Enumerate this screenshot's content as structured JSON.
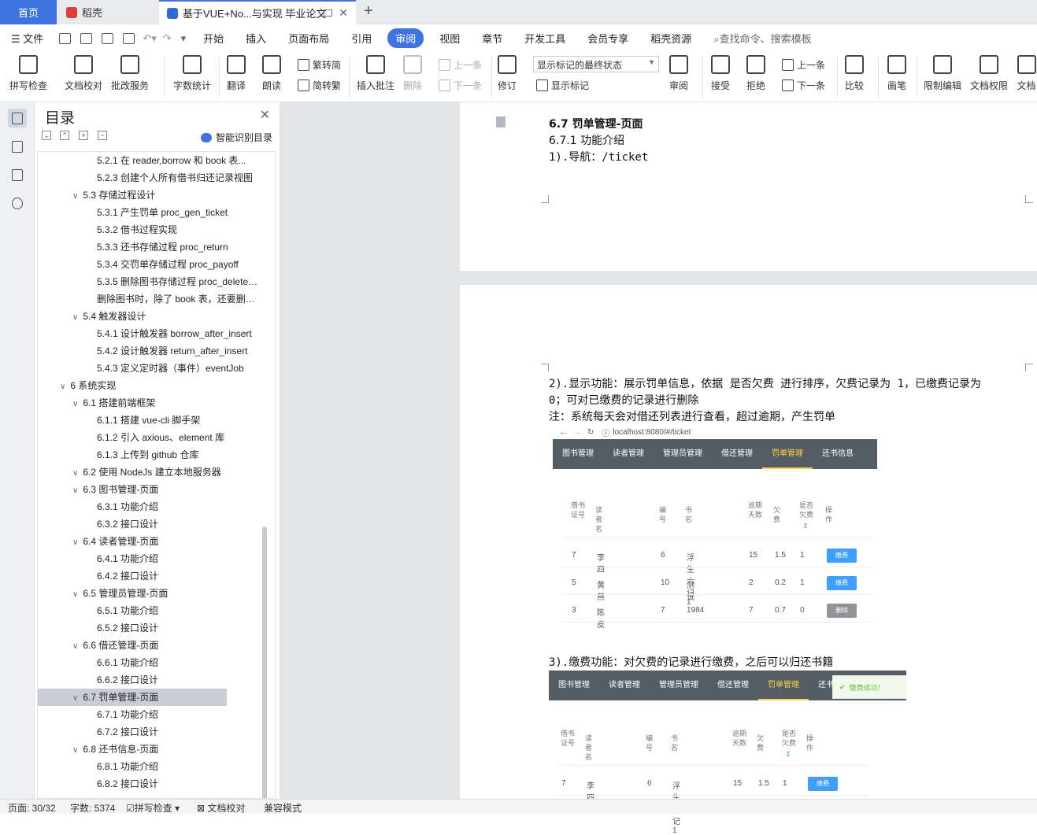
{
  "tabs": {
    "home": "首页",
    "daoke": "稻壳",
    "doc": "基于VUE+No...与实现 毕业论文"
  },
  "menu": {
    "file": "文件",
    "items": [
      "开始",
      "插入",
      "页面布局",
      "引用",
      "审阅",
      "视图",
      "章节",
      "开发工具",
      "会员专享",
      "稻壳资源"
    ],
    "active": "审阅",
    "search": "查找命令、搜索模板"
  },
  "toolbar": {
    "spell": "拼写检查",
    "proof": "文档校对",
    "batch": "批改服务",
    "wordcount": "字数统计",
    "translate": "翻译",
    "read": "朗读",
    "t2s": "繁转简",
    "s2t": "简转繁",
    "insert_comment": "插入批注",
    "delete": "删除",
    "prev": "上一条",
    "next": "下一条",
    "revise": "修订",
    "markup_state": "显示标记的最终状态",
    "show_markup": "显示标记",
    "review": "审阅",
    "accept": "接受",
    "reject": "拒绝",
    "prev2": "上一条",
    "next2": "下一条",
    "compare": "比较",
    "pen": "画笔",
    "restrict": "限制编辑",
    "perm": "文档权限",
    "docx": "文档"
  },
  "nav": {
    "title": "目录",
    "smart": "智能识别目录",
    "items": [
      {
        "text": "5.2.1 在 reader,borrow 和 book 表...",
        "level": 3
      },
      {
        "text": "5.2.3 创建个人所有借书归还记录视图",
        "level": 3
      },
      {
        "text": "5.3 存储过程设计",
        "level": 2
      },
      {
        "text": "5.3.1 产生罚单 proc_gen_ticket",
        "level": 3
      },
      {
        "text": "5.3.2 借书过程实现",
        "level": 3
      },
      {
        "text": "5.3.3 还书存储过程 proc_return",
        "level": 3
      },
      {
        "text": "5.3.4 交罚单存储过程 proc_payoff",
        "level": 3
      },
      {
        "text": "5.3.5 删除图书存储过程 proc_delete_book",
        "level": 3
      },
      {
        "text": "删除图书时，除了 book 表，还要删除...",
        "level": 3
      },
      {
        "text": "5.4 触发器设计",
        "level": 2
      },
      {
        "text": "5.4.1 设计触发器 borrow_after_insert",
        "level": 3
      },
      {
        "text": "5.4.2 设计触发器 return_after_insert",
        "level": 3
      },
      {
        "text": "5.4.3 定义定时器（事件）eventJob",
        "level": 3
      },
      {
        "text": "6 系统实现",
        "level": 1
      },
      {
        "text": "6.1 搭建前端框架",
        "level": 2
      },
      {
        "text": "6.1.1 搭建 vue-cli 脚手架",
        "level": 3
      },
      {
        "text": "6.1.2 引入 axious、element 库",
        "level": 3
      },
      {
        "text": "6.1.3 上传到 github 仓库",
        "level": 3
      },
      {
        "text": "6.2 使用 NodeJs 建立本地服务器",
        "level": 2
      },
      {
        "text": "6.3 图书管理-页面",
        "level": 2
      },
      {
        "text": "6.3.1 功能介绍",
        "level": 3
      },
      {
        "text": "6.3.2 接口设计",
        "level": 3
      },
      {
        "text": "6.4 读者管理-页面",
        "level": 2
      },
      {
        "text": "6.4.1 功能介绍",
        "level": 3
      },
      {
        "text": "6.4.2 接口设计",
        "level": 3
      },
      {
        "text": "6.5 管理员管理-页面",
        "level": 2
      },
      {
        "text": "6.5.1 功能介绍",
        "level": 3
      },
      {
        "text": "6.5.2 接口设计",
        "level": 3
      },
      {
        "text": "6.6 借还管理-页面",
        "level": 2
      },
      {
        "text": "6.6.1 功能介绍",
        "level": 3
      },
      {
        "text": "6.6.2 接口设计",
        "level": 3
      },
      {
        "text": "6.7 罚单管理-页面",
        "level": 2
      },
      {
        "text": "6.7.1 功能介绍",
        "level": 3
      },
      {
        "text": "6.7.2 接口设计",
        "level": 3
      },
      {
        "text": "6.8 还书信息-页面",
        "level": 2
      },
      {
        "text": "6.8.1 功能介绍",
        "level": 3
      },
      {
        "text": "6.8.2 接口设计",
        "level": 3
      }
    ],
    "selected": "6.7 罚单管理-页面"
  },
  "doc": {
    "h67": "6.7 罚单管理-页面",
    "h671": "6.7.1 功能介绍",
    "nav": "1).导航：/ticket",
    "p2a": "2).显示功能：展示罚单信息，依据 是否欠费 进行排序，欠费记录为 1，已缴费记录为",
    "p2b": "0；可对已缴费的记录进行删除",
    "p2c": "注：系统每天会对借还列表进行查看，超过逾期，产生罚单",
    "p3": "3).缴费功能：对欠费的记录进行缴费，之后可以归还书籍"
  },
  "shot1": {
    "url": "localhost:8080/#/ticket",
    "nav": [
      "图书管理",
      "读者管理",
      "管理员管理",
      "借还管理",
      "罚单管理",
      "还书信息"
    ],
    "active": "罚单管理",
    "headers": {
      "card": "借书证号",
      "reader": "读者名",
      "no": "编号",
      "title": "书名",
      "days": "逾期天数",
      "fee": "欠费",
      "owe": "是否欠费",
      "op": "操作"
    },
    "rows": [
      {
        "card": "7",
        "reader": "李四",
        "no": "6",
        "title": "浮生六记1",
        "days": "15",
        "fee": "1.5",
        "owe": "1",
        "btn": "缴费"
      },
      {
        "card": "5",
        "reader": "黄燕",
        "no": "10",
        "title": "测试",
        "days": "2",
        "fee": "0.2",
        "owe": "1",
        "btn": "缴费"
      },
      {
        "card": "3",
        "reader": "陈皮",
        "no": "7",
        "title": "1984",
        "days": "7",
        "fee": "0.7",
        "owe": "0",
        "btn": "删除"
      }
    ]
  },
  "shot2": {
    "nav": [
      "图书管理",
      "读者管理",
      "管理员管理",
      "借还管理",
      "罚单管理",
      "还书信息"
    ],
    "toast": "缴费成功！",
    "rows": [
      {
        "card": "7",
        "reader": "李四",
        "no": "6",
        "title": "浮生六记1",
        "days": "15",
        "fee": "1.5",
        "owe": "1",
        "btn": "缴费"
      }
    ]
  },
  "status": {
    "page": "页面: 30/32",
    "words": "字数: 5374",
    "spell": "拼写检查",
    "proof": "文档校对",
    "compat": "兼容模式"
  },
  "colors": {
    "accent": "#3f74e0",
    "nav_bg": "#545c64",
    "active_nav": "#ffd04b",
    "btn_blue": "#409eff",
    "btn_gray": "#909399"
  }
}
